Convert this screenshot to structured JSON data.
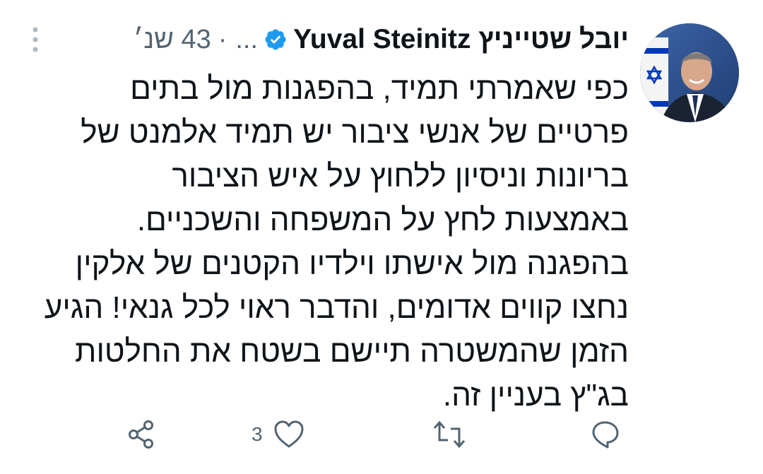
{
  "tweet": {
    "display_name": "יובל שטייניץ Yuval Steinitz",
    "handle": "...",
    "separator": "·",
    "time": "43 שנ׳",
    "body_lines": [
      "כפי שאמרתי תמיד, בהפגנות מול בתים",
      "פרטיים של אנשי ציבור יש תמיד אלמנט של",
      "בריונות וניסיון ללחוץ על איש הציבור",
      "באמצעות לחץ על המשפחה והשכניים.",
      "בהפגנה מול אישתו וילדיו הקטנים של אלקין",
      "נחצו קווים אדומים, והדבר ראוי לכל גנאי! הגיע",
      "הזמן שהמשטרה תיישם בשטח את החלטות",
      "בג\"ץ בעניין זה."
    ],
    "actions": {
      "like_count": "3"
    }
  },
  "colors": {
    "text": "#0f1419",
    "secondary": "#536471",
    "verified_blue": "#1d9bf0",
    "flag_blue": "#0038b8"
  },
  "icons": {
    "verified": "verified-badge-icon",
    "more": "more-vertical-icon",
    "share": "share-icon",
    "like": "heart-icon",
    "retweet": "retweet-icon",
    "reply": "reply-icon"
  }
}
